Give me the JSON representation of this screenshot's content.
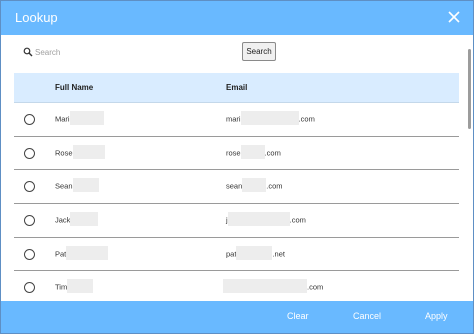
{
  "dialog": {
    "title": "Lookup",
    "close_icon": "close-icon"
  },
  "search": {
    "placeholder": "Search",
    "value": "",
    "button_label": "Search",
    "icon": "search-icon"
  },
  "table": {
    "columns": [
      "Full Name",
      "Email"
    ],
    "rows": [
      {
        "name": "Mari",
        "email_prefix": "mari",
        "email_suffix": ".com"
      },
      {
        "name": "Rose",
        "email_prefix": "rose",
        "email_suffix": ".com"
      },
      {
        "name": "Sean",
        "email_prefix": "sean",
        "email_suffix": ".com"
      },
      {
        "name": "Jack",
        "email_prefix": "j",
        "email_suffix": ".com"
      },
      {
        "name": "Pat",
        "email_prefix": "pat",
        "email_suffix": ".net"
      },
      {
        "name": "Tim",
        "email_prefix": "",
        "email_suffix": ".com"
      }
    ]
  },
  "footer": {
    "clear_label": "Clear",
    "cancel_label": "Cancel",
    "apply_label": "Apply"
  },
  "colors": {
    "accent": "#69b9ff",
    "header_bg": "#d9ecff"
  }
}
